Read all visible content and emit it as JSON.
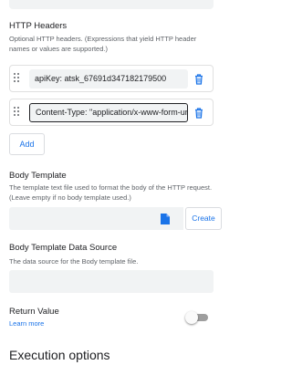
{
  "http_headers": {
    "title": "HTTP Headers",
    "description": "Optional HTTP headers. (Expressions that yield HTTP header names or values are supported.)",
    "rows": [
      {
        "value": "apiKey: atsk_67691d347182179500"
      },
      {
        "value": "Content-Type: \"application/x-www-form-urlencoded\""
      }
    ],
    "add_label": "Add"
  },
  "body_template": {
    "title": "Body Template",
    "description": "The template text file used to format the body of the HTTP request. (Leave empty if no body template used.)",
    "create_label": "Create"
  },
  "body_template_data_source": {
    "title": "Body Template Data Source",
    "description": "The data source for the Body template file."
  },
  "return_value": {
    "title": "Return Value",
    "learn_more": "Learn more",
    "enabled": false
  },
  "execution_options": {
    "title": "Execution options"
  },
  "colors": {
    "accent": "#1a73e8",
    "input_bg": "#f1f3f4",
    "border": "#dadce0",
    "text_secondary": "#5f6368"
  },
  "icons": [
    "drag-handle-icon",
    "delete-icon",
    "file-icon"
  ]
}
